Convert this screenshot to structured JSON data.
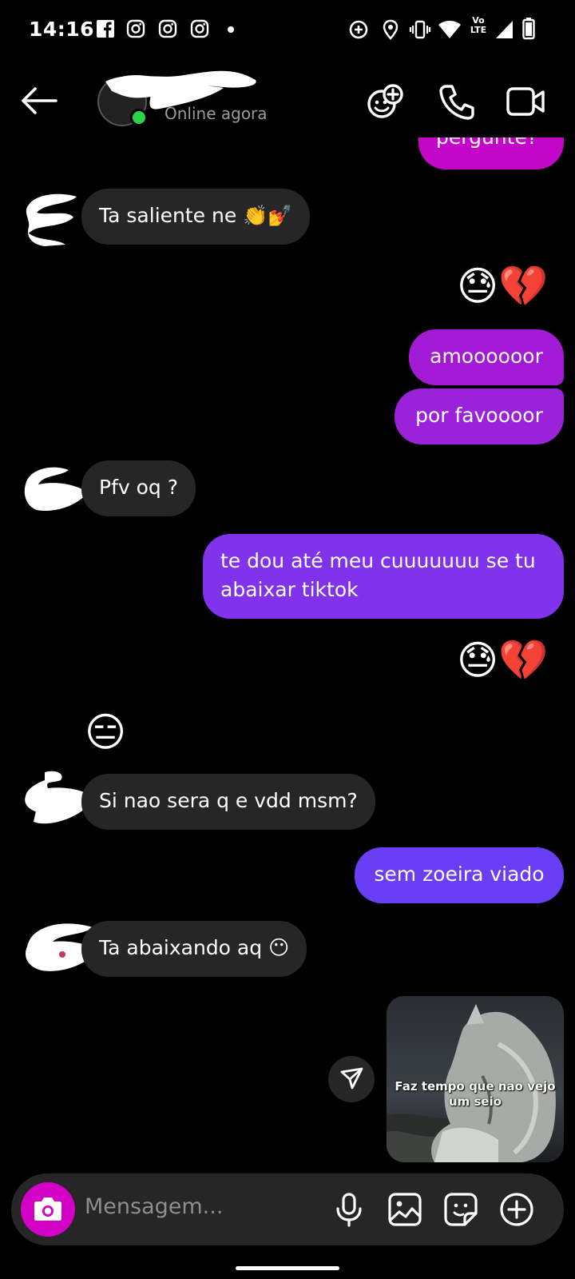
{
  "status_bar": {
    "time": "14:16",
    "left_icons": [
      "facebook-icon",
      "instagram-icon",
      "instagram-icon",
      "instagram-icon",
      "dot-icon"
    ],
    "right_icons": [
      "data-saver-icon",
      "location-icon",
      "vibrate-icon",
      "wifi-icon",
      "volte-icon",
      "signal-icon",
      "battery-icon"
    ],
    "volte_label_top": "Vo",
    "volte_label_bottom": "LTE"
  },
  "header": {
    "contact_status": "Online agora",
    "buttons": [
      "add-people-icon",
      "phone-icon",
      "video-icon"
    ]
  },
  "messages": [
    {
      "id": "m0",
      "side": "out",
      "text": "pergunte?",
      "color": "#c207c8"
    },
    {
      "id": "m1",
      "side": "in",
      "text": "Ta saliente ne",
      "emoji": "👏💅"
    },
    {
      "id": "m2",
      "side": "out",
      "emoji": "😓💔"
    },
    {
      "id": "m3",
      "side": "out",
      "text": "amoooooor",
      "color": "#a219d6"
    },
    {
      "id": "m4",
      "side": "out",
      "text": "por favoooor",
      "color": "#9a22d9"
    },
    {
      "id": "m5",
      "side": "in",
      "text": "Pfv oq ?"
    },
    {
      "id": "m6",
      "side": "out",
      "text_lines": [
        "te dou até meu cuuuuuuu se tu",
        "abaixar tiktok"
      ],
      "color": "#8132eb"
    },
    {
      "id": "m7",
      "side": "out",
      "emoji": "😓💔"
    },
    {
      "id": "m8",
      "side": "in",
      "emoji": "😑"
    },
    {
      "id": "m9",
      "side": "in",
      "text": "Si nao sera q e vdd msm?"
    },
    {
      "id": "m10",
      "side": "out",
      "text": "sem zoeira viado",
      "color": "#6a3ef5"
    },
    {
      "id": "m11",
      "side": "in",
      "text": "Ta abaixando aq",
      "emoji": "😶"
    },
    {
      "id": "m12",
      "side": "out",
      "image_caption": "Faz tempo que nao vejo um seio"
    }
  ],
  "composer": {
    "placeholder": "Mensagem...",
    "icons": [
      "camera-icon",
      "microphone-icon",
      "gallery-icon",
      "sticker-icon",
      "plus-icon"
    ]
  },
  "colors": {
    "background": "#000000",
    "incoming_bubble": "#262626",
    "camera_button": "#d300c5",
    "online": "#2bd34b"
  }
}
